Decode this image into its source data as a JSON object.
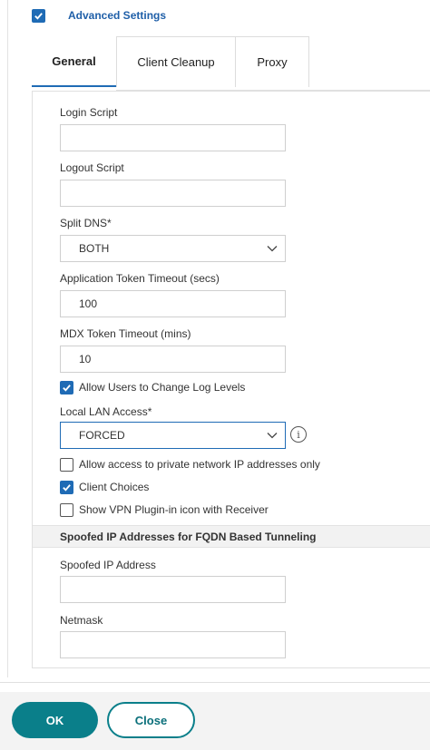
{
  "advanced_settings": {
    "label": "Advanced Settings",
    "checked": true
  },
  "tabs": [
    {
      "label": "General",
      "active": true
    },
    {
      "label": "Client Cleanup",
      "active": false
    },
    {
      "label": "Proxy",
      "active": false
    }
  ],
  "fields": {
    "login_script": {
      "label": "Login Script",
      "value": ""
    },
    "logout_script": {
      "label": "Logout Script",
      "value": ""
    },
    "split_dns": {
      "label": "Split DNS*",
      "value": "BOTH"
    },
    "app_token_timeout": {
      "label": "Application Token Timeout (secs)",
      "value": "100"
    },
    "mdx_token_timeout": {
      "label": "MDX Token Timeout (mins)",
      "value": "10"
    },
    "allow_change_log_levels": {
      "label": "Allow Users to Change Log Levels",
      "checked": true
    },
    "local_lan_access": {
      "label": "Local LAN Access*",
      "value": "FORCED"
    },
    "allow_private_only": {
      "label": "Allow access to private network IP addresses only",
      "checked": false
    },
    "client_choices": {
      "label": "Client Choices",
      "checked": true
    },
    "show_vpn_plugin_icon": {
      "label": "Show VPN Plugin-in icon with Receiver",
      "checked": false
    }
  },
  "spoofed_section": {
    "title": "Spoofed IP Addresses for FQDN Based Tunneling",
    "spoofed_ip": {
      "label": "Spoofed IP Address",
      "value": ""
    },
    "netmask": {
      "label": "Netmask",
      "value": ""
    }
  },
  "footer": {
    "ok_label": "OK",
    "close_label": "Close"
  },
  "colors": {
    "accent": "#1f6bb5",
    "primary_button": "#0a7f8a",
    "footer_bg": "#f3f3f3"
  },
  "icons": {
    "check": "check-icon",
    "chevron": "chevron-down-icon",
    "info": "info-icon"
  }
}
